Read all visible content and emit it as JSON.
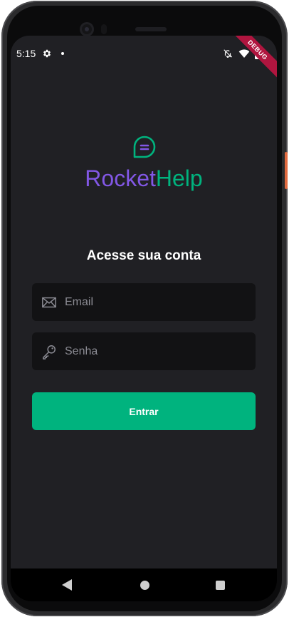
{
  "status_bar": {
    "time": "5:15"
  },
  "debug_ribbon": "DEBUG",
  "brand": {
    "part1": "Rocket",
    "part2": "Help"
  },
  "heading": "Acesse sua conta",
  "email_field": {
    "placeholder": "Email",
    "value": ""
  },
  "password_field": {
    "placeholder": "Senha",
    "value": ""
  },
  "submit_label": "Entrar",
  "colors": {
    "background": "#202024",
    "field_background": "#121214",
    "brand_purple": "#8257e5",
    "brand_green": "#00b37e",
    "button": "#00b37e"
  },
  "icons": [
    "gear-icon",
    "notification-dot-icon",
    "mute-icon",
    "wifi-icon",
    "battery-icon",
    "chat-bubble-icon",
    "mail-icon",
    "key-icon",
    "nav-back-icon",
    "nav-home-icon",
    "nav-recent-icon"
  ]
}
